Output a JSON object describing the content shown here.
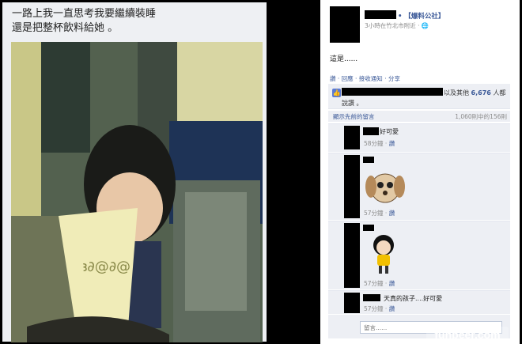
{
  "caption": {
    "line1": "一路上我一直思考我要繼續裝睡",
    "line2": "還是把整杯飲料給她 。"
  },
  "cup_pattern": "ꜣ∂@∂@",
  "post": {
    "page_name": "• 【爆料公社】",
    "meta": "3小時在竹北市附近 · 🌐",
    "text": "這是......",
    "actions": "讚 · 回應 · 接收通知 · 分享"
  },
  "likes": {
    "prefix": "以及其他",
    "count": "6,676",
    "suffix": "人都",
    "line2": "說讚 。"
  },
  "comments_nav": {
    "previous": "顯示先前的留言",
    "count": "1,060則中的156則"
  },
  "comments": [
    {
      "text": "好可愛",
      "time": "58分鐘",
      "like": "讚"
    },
    {
      "text": "",
      "time": "57分鐘",
      "like": "讚"
    },
    {
      "text": "",
      "time": "57分鐘",
      "like": "讚"
    },
    {
      "text": "天真的孩子....好可愛",
      "time": "57分鐘",
      "like": "讚"
    }
  ],
  "comment_input": {
    "placeholder": "留言......"
  },
  "watermark": "funpeer.com"
}
